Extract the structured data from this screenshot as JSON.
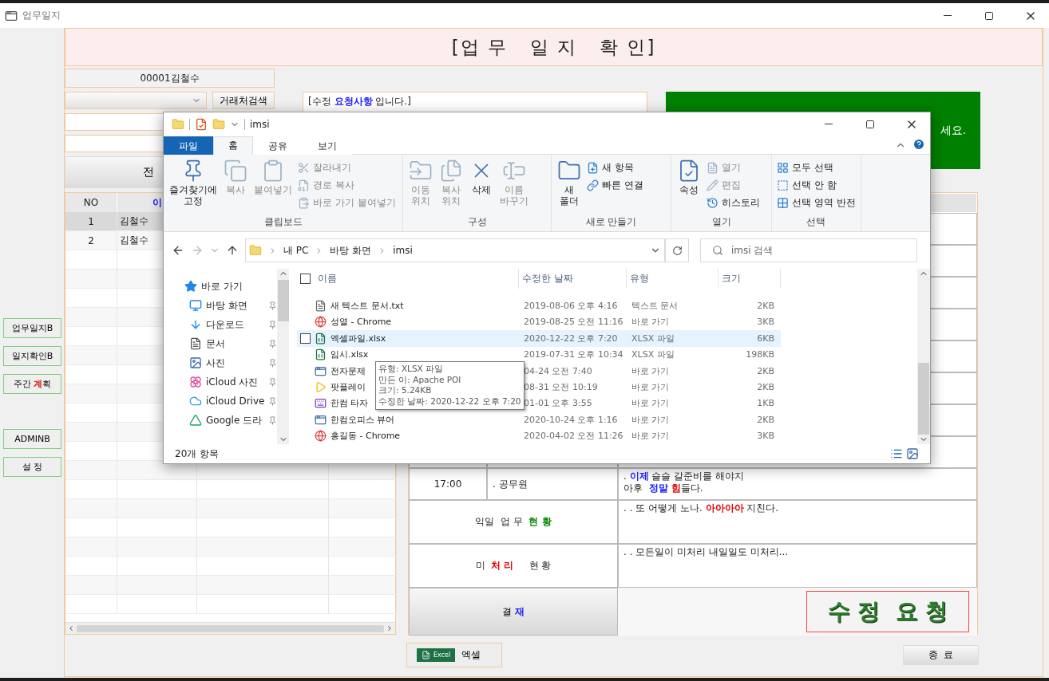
{
  "app": {
    "title": "업무일지",
    "header": "[업 무   일 지   확 인]",
    "employee": "00001김철수",
    "partner_search_button": "거래처검색",
    "all_button": "전",
    "memo": [
      {
        "text": "[수정 "
      },
      {
        "text": "요청사항",
        "color": "#1a1aff"
      },
      {
        "text": " 입니다.]"
      }
    ],
    "notice_tail": "세요.",
    "sidebar_buttons": [
      {
        "parts": [
          {
            "text": "업무일지B"
          }
        ]
      },
      {
        "parts": [
          {
            "text": "일지확인B"
          }
        ]
      },
      {
        "parts": [
          {
            "text": "주간 "
          },
          {
            "text": "계",
            "color": "#e00000"
          },
          {
            "text": "획"
          }
        ]
      },
      {
        "parts": [
          {
            "text": "ADMINB"
          }
        ]
      },
      {
        "parts": [
          {
            "text": "설  정"
          }
        ]
      }
    ],
    "grid": {
      "columns": [
        {
          "text": "NO"
        },
        {
          "text": "이",
          "color": "#1a1aff"
        }
      ],
      "rows": [
        {
          "no": "1",
          "name": "김철수",
          "selected": true
        },
        {
          "no": "2",
          "name": "김철수",
          "selected": false
        }
      ]
    },
    "journal": {
      "entries": [
        {
          "time": "17:00",
          "task": ". 공무원",
          "note": [
            [
              {
                "text": ". "
              },
              {
                "text": "이제",
                "color": "#1a1aff"
              },
              {
                "text": " 슬슬 갈준비를 해야지"
              }
            ],
            [
              {
                "text": "아후  "
              },
              {
                "text": "정말 ",
                "color": "#1a1aff"
              },
              {
                "text": "힘",
                "color": "#e00000"
              },
              {
                "text": "들다."
              }
            ]
          ]
        }
      ],
      "sections": [
        {
          "label": [
            {
              "text": "익일  업 무  "
            },
            {
              "text": "현 황",
              "color": "#008800"
            }
          ],
          "note": [
            {
              "text": ". . 또 어떻게 노나. "
            },
            {
              "text": "아아아아",
              "color": "#e00000"
            },
            {
              "text": " 지친다."
            }
          ]
        },
        {
          "label": [
            {
              "text": "미  "
            },
            {
              "text": "처 리",
              "color": "#e00000"
            },
            {
              "text": "     현 황"
            }
          ],
          "note": [
            {
              "text": ". . 모든일이 미처리 내일일도 미처리..."
            }
          ]
        }
      ],
      "approve": [
        {
          "text": "결 "
        },
        {
          "text": "재",
          "color": "#1a1aff"
        }
      ],
      "request_button": "수 정  요 청"
    },
    "excel_button": {
      "badge": "Excel",
      "label": "엑셀"
    },
    "close_button": "종  료"
  },
  "explorer": {
    "title": "imsi",
    "tabs": [
      {
        "label": "파일",
        "kind": "file",
        "selected": false
      },
      {
        "label": "홈",
        "kind": "tab",
        "selected": true
      },
      {
        "label": "공유",
        "kind": "tab",
        "selected": false
      },
      {
        "label": "보기",
        "kind": "tab",
        "selected": false
      }
    ],
    "ribbon": [
      {
        "name": "클립보드",
        "large": [
          {
            "label": "즐겨찾기에\n고정",
            "disabled": false
          },
          {
            "label": "복사",
            "disabled": true
          },
          {
            "label": "붙여넣기",
            "disabled": true
          }
        ],
        "small": [
          {
            "label": "잘라내기",
            "disabled": true
          },
          {
            "label": "경로 복사",
            "disabled": true
          },
          {
            "label": "바로 가기 붙여넣기",
            "disabled": true
          }
        ]
      },
      {
        "name": "구성",
        "large": [
          {
            "label": "이동\n위치",
            "disabled": true
          },
          {
            "label": "복사\n위치",
            "disabled": true
          },
          {
            "label": "삭제",
            "disabled": false
          },
          {
            "label": "이름\n바꾸기",
            "disabled": true
          }
        ]
      },
      {
        "name": "새로 만들기",
        "large": [
          {
            "label": "새\n폴더",
            "disabled": false
          }
        ],
        "small": [
          {
            "label": "새 항목",
            "disabled": false
          },
          {
            "label": "빠른 연결",
            "disabled": false
          }
        ]
      },
      {
        "name": "열기",
        "large": [
          {
            "label": "속성",
            "disabled": false
          }
        ],
        "small": [
          {
            "label": "열기",
            "disabled": true
          },
          {
            "label": "편집",
            "disabled": true
          },
          {
            "label": "히스토리",
            "disabled": false
          }
        ]
      },
      {
        "name": "선택",
        "small": [
          {
            "label": "모두 선택",
            "disabled": false
          },
          {
            "label": "선택 안 함",
            "disabled": false
          },
          {
            "label": "선택 영역 반전",
            "disabled": false
          }
        ]
      }
    ],
    "path": [
      "내 PC",
      "바탕 화면",
      "imsi"
    ],
    "search": {
      "placeholder": "imsi 검색"
    },
    "nav": [
      {
        "label": "바로 가기",
        "kind": "star"
      },
      {
        "label": "바탕 화면",
        "kind": "desktop"
      },
      {
        "label": "다운로드",
        "kind": "download"
      },
      {
        "label": "문서",
        "kind": "doc"
      },
      {
        "label": "사진",
        "kind": "image"
      },
      {
        "label": "iCloud 사진",
        "kind": "photos"
      },
      {
        "label": "iCloud Drive",
        "kind": "cloud"
      },
      {
        "label": "Google 드라",
        "kind": "drive"
      }
    ],
    "select_all": {
      "checked": false
    },
    "columns": [
      "이름",
      "수정한 날짜",
      "유형",
      "크기"
    ],
    "files": [
      {
        "name": "새 텍스트 문서.txt",
        "date": "2019-08-06 오후 4:16",
        "type": "텍스트 문서",
        "size": "2KB",
        "kind": "text",
        "selected": false
      },
      {
        "name": "성열 - Chrome",
        "date": "2019-08-25 오전 11:16",
        "type": "바로 가기",
        "size": "3KB",
        "kind": "web",
        "selected": false
      },
      {
        "name": "엑셀파일.xlsx",
        "date": "2020-12-22 오후 7:20",
        "type": "XLSX 파일",
        "size": "6KB",
        "kind": "excel",
        "selected": true
      },
      {
        "name": "임시.xlsx",
        "date": "2019-07-31 오후 10:34",
        "type": "XLSX 파일",
        "size": "198KB",
        "kind": "excel",
        "selected": false
      },
      {
        "name": "전자문제",
        "date": "04-24 오전 7:40",
        "type": "바로 가기",
        "size": "2KB",
        "kind": "app",
        "selected": false
      },
      {
        "name": "팟플레이",
        "date": "08-31 오전 10:19",
        "type": "바로 가기",
        "size": "2KB",
        "kind": "player",
        "selected": false
      },
      {
        "name": "한컴 타자",
        "date": "01-01 오후 3:55",
        "type": "바로 가기",
        "size": "1KB",
        "kind": "keyboard",
        "selected": false
      },
      {
        "name": "한컴오피스 뷰어",
        "date": "2020-10-24 오후 1:16",
        "type": "바로 가기",
        "size": "2KB",
        "kind": "app",
        "selected": false
      },
      {
        "name": "홍길동 - Chrome",
        "date": "2020-04-02 오전 11:26",
        "type": "바로 가기",
        "size": "3KB",
        "kind": "web",
        "selected": false
      }
    ],
    "tooltip": [
      "유형: XLSX 파일",
      "만든 이: Apache POI",
      "크기: 5.24KB",
      "수정한 날짜: 2020-12-22 오후 7:20"
    ],
    "status": "20개 항목"
  }
}
